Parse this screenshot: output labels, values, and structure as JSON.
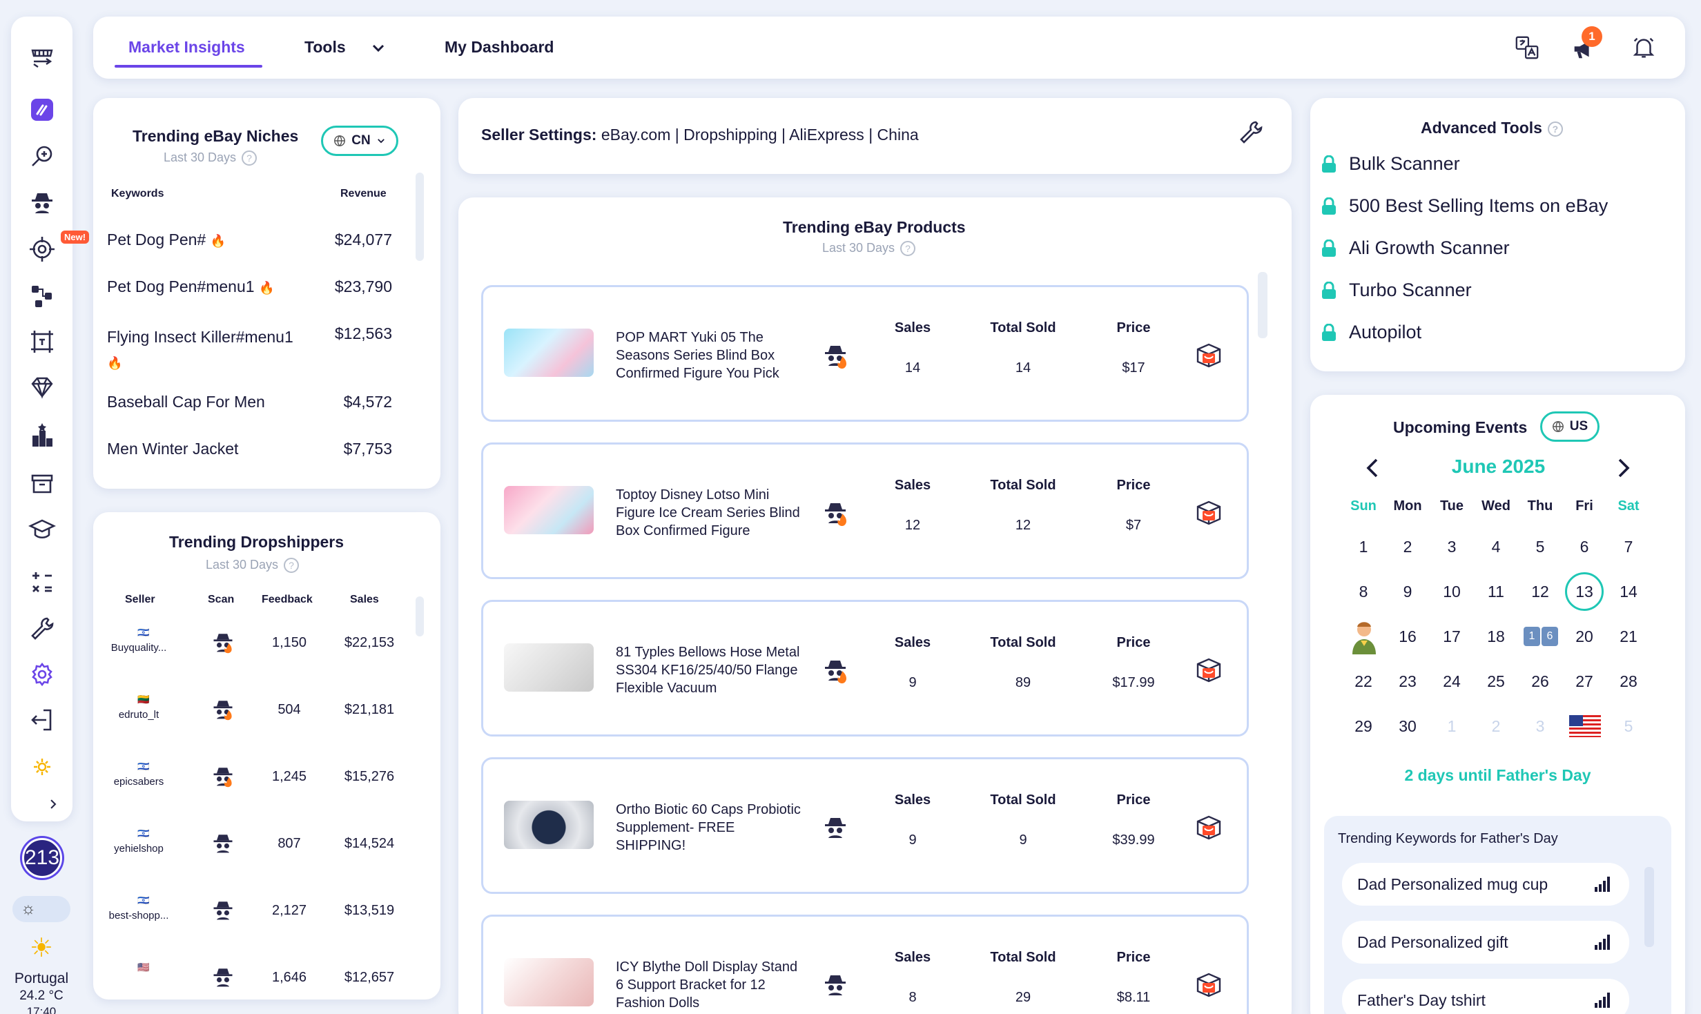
{
  "sidebar": {
    "new_badge": "New!",
    "icons": [
      "store-switch-icon",
      "brand-logo-icon",
      "search-zoom-icon",
      "spy-icon",
      "target-icon",
      "workflow-icon",
      "frame-icon",
      "diamond-icon",
      "ranking-icon",
      "archive-icon",
      "academy-icon",
      "calculator-icon",
      "wrench-icon",
      "settings-icon",
      "logout-icon",
      "sun-icon",
      "expand-chevron-icon"
    ],
    "score": "213",
    "weather": {
      "city": "Portugal",
      "temp": "24.2 °C",
      "time": "17:40"
    }
  },
  "nav": {
    "tabs": [
      "Market Insights",
      "Tools",
      "My Dashboard"
    ],
    "active": "Market Insights",
    "notif_count": "1"
  },
  "niches": {
    "title": "Trending eBay Niches",
    "subtitle": "Last 30 Days",
    "country": "CN",
    "col_keywords": "Keywords",
    "col_revenue": "Revenue",
    "rows": [
      {
        "kw": "Pet Dog Pen#",
        "rev": "$24,077"
      },
      {
        "kw": "Pet Dog Pen#menu1",
        "rev": "$23,790"
      },
      {
        "kw": "Flying Insect Killer#menu1",
        "rev": "$12,563"
      },
      {
        "kw": "Baseball Cap For Men",
        "rev": "$4,572"
      },
      {
        "kw": "Men Winter Jacket",
        "rev": "$7,753"
      }
    ]
  },
  "dropshippers": {
    "title": "Trending Dropshippers",
    "subtitle": "Last 30 Days",
    "col_seller": "Seller",
    "col_scan": "Scan",
    "col_feedback": "Feedback",
    "col_sales": "Sales",
    "rows": [
      {
        "name": "Buyquality...",
        "feedback": "1,150",
        "sales": "$22,153",
        "flag": "🇮🇱"
      },
      {
        "name": "edruto_lt",
        "feedback": "504",
        "sales": "$21,181",
        "flag": "🇱🇹"
      },
      {
        "name": "epicsabers",
        "feedback": "1,245",
        "sales": "$15,276",
        "flag": "🇮🇱"
      },
      {
        "name": "yehielshop",
        "feedback": "807",
        "sales": "$14,524",
        "flag": "🇮🇱"
      },
      {
        "name": "best-shopp...",
        "feedback": "2,127",
        "sales": "$13,519",
        "flag": "🇮🇱"
      },
      {
        "name": "",
        "feedback": "1,646",
        "sales": "$12,657",
        "flag": "🇺🇸"
      }
    ]
  },
  "seller_settings": {
    "label": "Seller Settings:",
    "value": "eBay.com | Dropshipping | AliExpress | China"
  },
  "products": {
    "title": "Trending eBay Products",
    "subtitle": "Last 30 Days",
    "col_sales": "Sales",
    "col_total": "Total Sold",
    "col_price": "Price",
    "items": [
      {
        "name": "POP MART Yuki 05 The Seasons Series Blind Box Confirmed Figure You Pick",
        "sales": "14",
        "total": "14",
        "price": "$17"
      },
      {
        "name": "Toptoy Disney Lotso Mini Figure Ice Cream Series Blind Box Confirmed Figure",
        "sales": "12",
        "total": "12",
        "price": "$7"
      },
      {
        "name": "81 Typles Bellows Hose Metal SS304 KF16/25/40/50 Flange Flexible Vacuum",
        "sales": "9",
        "total": "89",
        "price": "$17.99"
      },
      {
        "name": "Ortho Biotic 60 Caps Probiotic Supplement- FREE SHIPPING!",
        "sales": "9",
        "total": "9",
        "price": "$39.99"
      },
      {
        "name": "ICY Blythe Doll Display Stand 6 Support Bracket for 12 Fashion Dolls",
        "sales": "8",
        "total": "29",
        "price": "$8.11"
      }
    ]
  },
  "advanced": {
    "title": "Advanced Tools",
    "items": [
      "Bulk Scanner",
      "500 Best Selling Items on eBay",
      "Ali Growth Scanner",
      "Turbo Scanner",
      "Autopilot"
    ]
  },
  "events": {
    "title": "Upcoming Events",
    "country": "US",
    "month": "June 2025",
    "weekdays": [
      "Sun",
      "Mon",
      "Tue",
      "Wed",
      "Thu",
      "Fri",
      "Sat"
    ],
    "weeks": [
      [
        "1",
        "2",
        "3",
        "4",
        "5",
        "6",
        "7"
      ],
      [
        "8",
        "9",
        "10",
        "11",
        "12",
        "13",
        "14"
      ],
      [
        "",
        "16",
        "17",
        "18",
        "",
        "20",
        "21"
      ],
      [
        "22",
        "23",
        "24",
        "25",
        "26",
        "27",
        "28"
      ],
      [
        "29",
        "30",
        "1",
        "2",
        "3",
        "",
        "5"
      ]
    ],
    "today": "13",
    "countdown": "2 days until Father's Day",
    "kw_title": "Trending Keywords for Father's Day",
    "keywords": [
      "Dad Personalized mug cup",
      "Dad Personalized gift",
      "Father's Day tshirt"
    ]
  },
  "colors": {
    "accent": "#6b45e8",
    "teal": "#1fc7b5",
    "orange": "#ff6a2a",
    "navy": "#2a2480"
  }
}
